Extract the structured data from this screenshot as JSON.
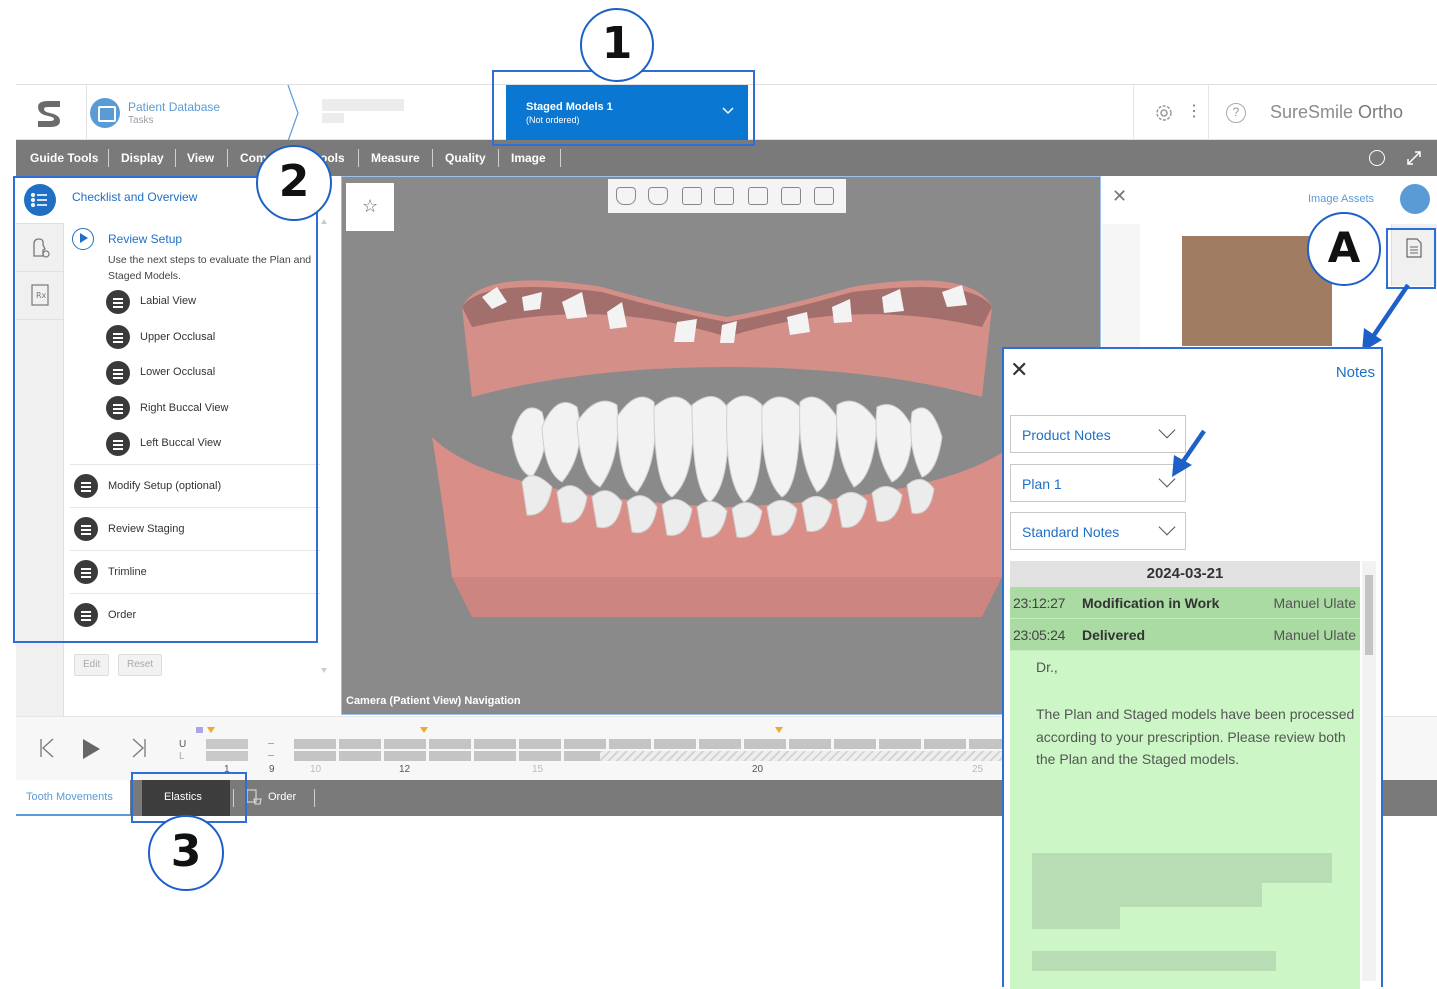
{
  "header": {
    "patient_db_title": "Patient Database",
    "patient_db_sub": "Tasks",
    "staged_title": "Staged Models 1",
    "staged_sub": "(Not ordered)",
    "brand_main": "SureSmile",
    "brand_suffix": "Ortho"
  },
  "menubar": {
    "items": [
      "Guide Tools",
      "Display",
      "View",
      "Com",
      "ools",
      "Measure",
      "Quality",
      "Image"
    ]
  },
  "checklist": {
    "title": "Checklist and Overview",
    "review_title": "Review Setup",
    "review_desc": "Use the next steps to evaluate the Plan and Staged Models.",
    "sub_steps": [
      "Labial View",
      "Upper Occlusal",
      "Lower Occlusal",
      "Right Buccal View",
      "Left Buccal View"
    ],
    "main_steps": [
      "Modify Setup (optional)",
      "Review Staging",
      "Trimline",
      "Order"
    ],
    "edit_label": "Edit",
    "reset_label": "Reset"
  },
  "viewport": {
    "camera_label": "Camera (Patient View) Navigation"
  },
  "right_panel": {
    "assets_label": "Image Assets"
  },
  "timeline": {
    "row_upper": "U",
    "row_lower": "L",
    "numbers": [
      "1",
      "9",
      "10",
      "12",
      "15",
      "20",
      "25"
    ]
  },
  "tabs": {
    "tooth_movements": "Tooth Movements",
    "elastics": "Elastics",
    "order": "Order"
  },
  "callouts": [
    "1",
    "2",
    "3",
    "A"
  ],
  "notes": {
    "title": "Notes",
    "selects": [
      "Product Notes",
      "Plan 1",
      "Standard Notes"
    ],
    "date": "2024-03-21",
    "entries": [
      {
        "time": "23:12:27",
        "event": "Modification in Work",
        "user": "Manuel Ulate"
      },
      {
        "time": "23:05:24",
        "event": "Delivered",
        "user": "Manuel Ulate"
      }
    ],
    "greeting": "Dr.,",
    "message": "The Plan and Staged models have been processed according to your prescription. Please review both the Plan and the Staged models."
  },
  "colors": {
    "accent": "#0a78d2",
    "callout_border": "#1d60c8",
    "notes_bg": "#ccf6c6",
    "notes_row": "#a9dba2"
  }
}
